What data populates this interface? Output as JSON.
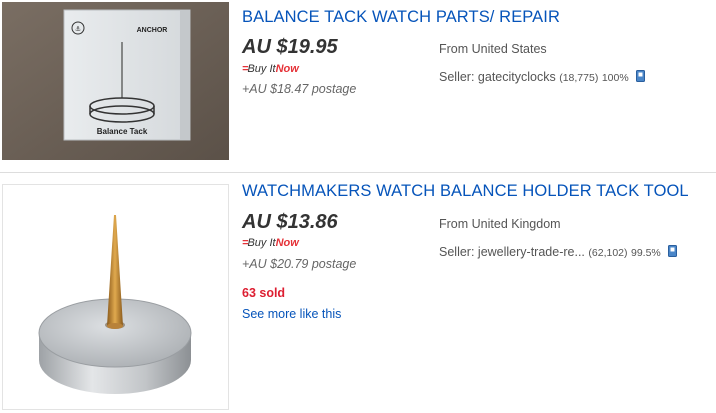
{
  "listings": [
    {
      "title": "BALANCE TACK WATCH PARTS/ REPAIR",
      "price": "AU $19.95",
      "buy_it_now": {
        "marks": "=",
        "text": "Buy It",
        "now": "Now"
      },
      "postage": "+AU $18.47 postage",
      "location": "From United States",
      "seller": {
        "prefix": "Seller:",
        "name": "gatecityclocks",
        "feedback": "(18,775)",
        "percent": "100%"
      },
      "image": {
        "box_brand": "ANCHOR",
        "box_label": "Balance Tack"
      }
    },
    {
      "title": "WATCHMAKERS WATCH BALANCE HOLDER TACK TOOL",
      "price": "AU $13.86",
      "buy_it_now": {
        "marks": "=",
        "text": "Buy It",
        "now": "Now"
      },
      "postage": "+AU $20.79 postage",
      "location": "From United Kingdom",
      "seller": {
        "prefix": "Seller:",
        "name": "jewellery-trade-re...",
        "feedback": "(62,102)",
        "percent": "99.5%"
      },
      "sold": "63 sold",
      "see_more": "See more like this"
    }
  ],
  "colors": {
    "link": "#0654ba",
    "price": "#333333",
    "buy_it_now_red": "#e53238",
    "sold_red": "#dd1e31"
  },
  "icons": [
    "store-icon"
  ]
}
